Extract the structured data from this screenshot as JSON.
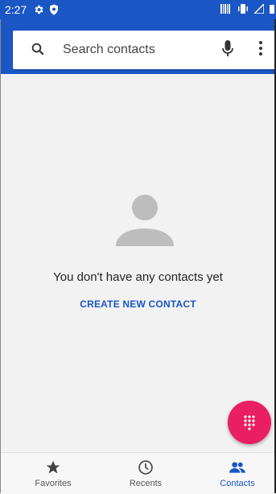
{
  "status_bar": {
    "time": "2:27"
  },
  "search": {
    "placeholder": "Search contacts"
  },
  "empty_state": {
    "message": "You don't have any contacts yet",
    "create_label": "CREATE NEW CONTACT"
  },
  "nav": {
    "items": [
      {
        "label": "Favorites",
        "icon": "star-icon",
        "active": false
      },
      {
        "label": "Recents",
        "icon": "clock-icon",
        "active": false
      },
      {
        "label": "Contacts",
        "icon": "people-icon",
        "active": true
      }
    ]
  },
  "colors": {
    "primary": "#1a56c4",
    "fab": "#ea1e63",
    "avatar": "#bdbdbd"
  }
}
